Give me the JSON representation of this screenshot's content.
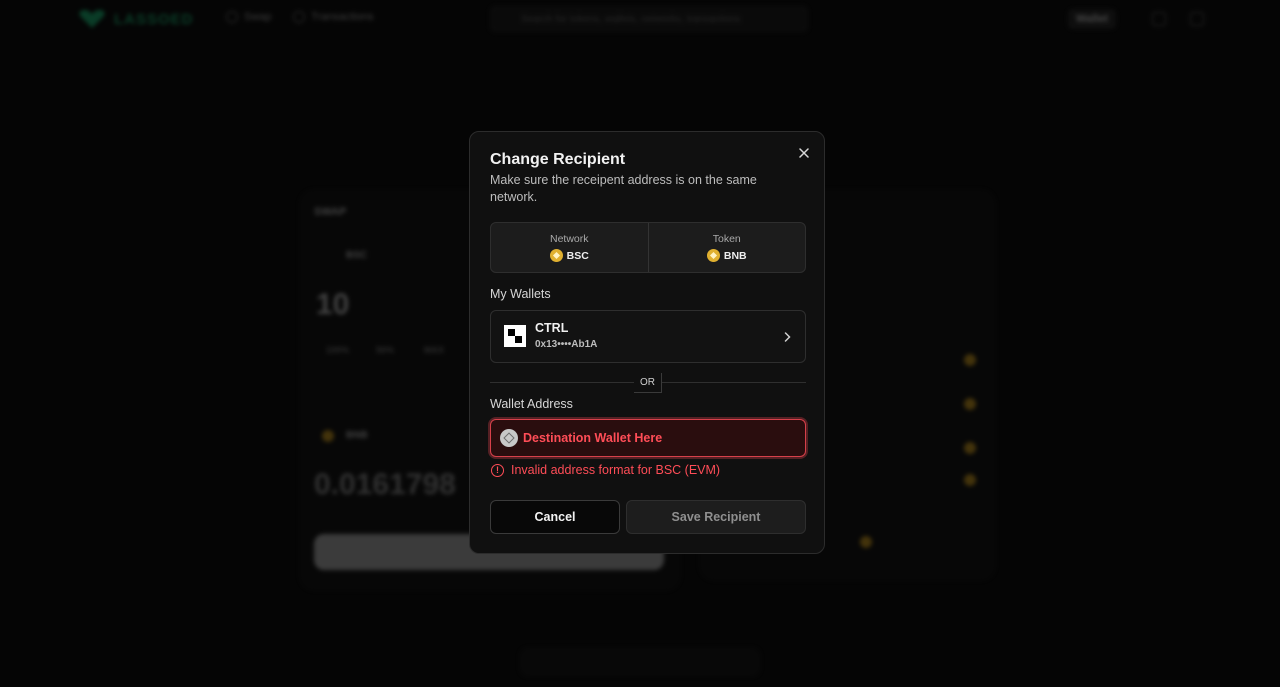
{
  "background": {
    "logo_text": "LASSOED",
    "nav": [
      {
        "label": "Swap"
      },
      {
        "label": "Transactions"
      }
    ],
    "search_placeholder": "Search for tokens, wallets, networks, transactions",
    "wallet_button": "Wallet",
    "left_card": {
      "title": "SWAP",
      "token": "BSC",
      "amount": "10",
      "quick_amounts": [
        "100%",
        "50%",
        "MAX"
      ],
      "token2": "BNB",
      "receive_amount": "0.0161798"
    }
  },
  "modal": {
    "title": "Change Recipient",
    "subtitle": "Make sure the receipent address is on the same network.",
    "network_label": "Network",
    "network_value": "BSC",
    "token_label": "Token",
    "token_value": "BNB",
    "my_wallets_label": "My Wallets",
    "wallet": {
      "name": "CTRL",
      "address": "0x13••••Ab1A"
    },
    "or_label": "OR",
    "wallet_address_label": "Wallet Address",
    "address_placeholder": "Destination Wallet Here",
    "error_message": "Invalid address format for BSC (EVM)",
    "cancel_label": "Cancel",
    "save_label": "Save Recipient"
  },
  "colors": {
    "error": "#ff4d57",
    "accent_green": "#1bbf7a",
    "bnb_gold": "#e0b030"
  },
  "icons": {
    "close": "close-icon",
    "chevron": "chevron-right-icon",
    "error": "alert-circle-icon"
  }
}
